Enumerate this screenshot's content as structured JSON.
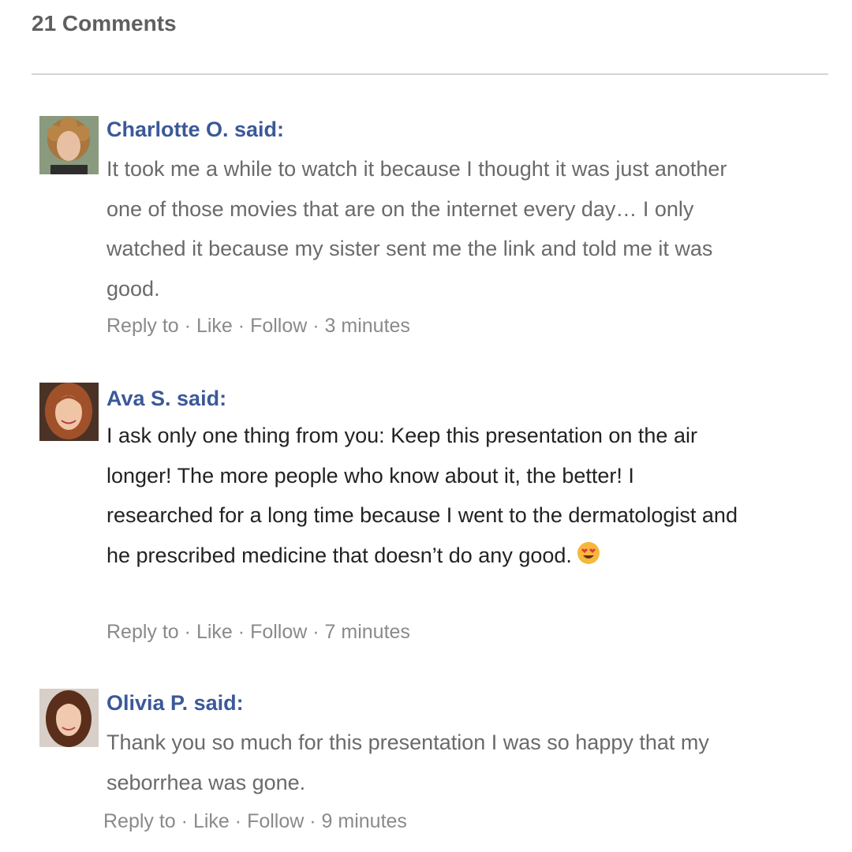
{
  "comments_header": "21 Comments",
  "separator": "·",
  "comments": [
    {
      "author": "Charlotte O. said:",
      "text": "It took me a while to watch it because I thought it was just another one of those movies that are on the internet every day… I only watched it because my sister sent me the link and told me it was good.",
      "emoji": "",
      "reply_label": "Reply to",
      "like_label": "Like",
      "follow_label": "Follow",
      "time": "3 minutes",
      "avatar_icon": "avatar-curly-hair-woman"
    },
    {
      "author": "Ava S. said:",
      "text": "I ask only one thing from you: Keep this presentation on the air longer! The more people who know about it, the better! I researched for a long time because I went to the dermatologist and he prescribed medicine that doesn’t do any good.",
      "emoji": "heart-eyes-emoji",
      "reply_label": "Reply to",
      "like_label": "Like",
      "follow_label": "Follow",
      "time": "7 minutes",
      "avatar_icon": "avatar-red-hair-woman"
    },
    {
      "author": "Olivia P. said:",
      "text": "Thank you so much for this presentation I was so happy that my seborrhea was gone.",
      "emoji": "",
      "reply_label": "Reply to",
      "like_label": "Like",
      "follow_label": "Follow",
      "time": "9 minutes",
      "avatar_icon": "avatar-brown-hair-woman"
    }
  ],
  "colors": {
    "author_link": "#3b5998",
    "body_text_muted": "#6a6a6a",
    "body_text_dark": "#222222",
    "meta_text": "#8a8a8a",
    "divider": "#d4d4d4"
  }
}
